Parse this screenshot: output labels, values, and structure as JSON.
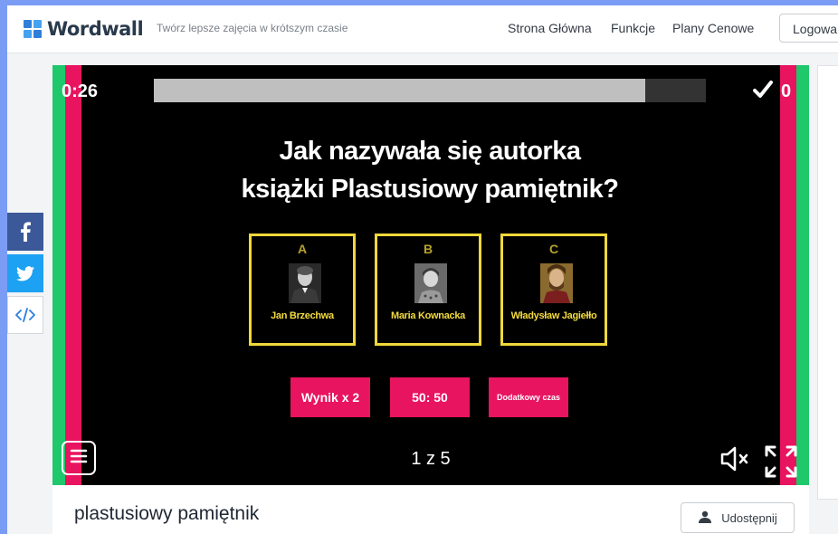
{
  "header": {
    "logo_text": "Wordwall",
    "tagline": "Twórz lepsze zajęcia w krótszym czasie",
    "nav": [
      "Strona Główna",
      "Funkcje",
      "Plany Cenowe"
    ],
    "login_label": "Logowa"
  },
  "social": {
    "facebook": "facebook-icon",
    "twitter": "twitter-icon",
    "embed": "embed-code-icon"
  },
  "game": {
    "timer": "0:26",
    "progress": 0.89,
    "score": "0",
    "question_line1": "Jak nazywała się autorka",
    "question_line2": "książki Plastusiowy pamiętnik?",
    "answers": [
      {
        "letter": "A",
        "name": "Jan Brzechwa"
      },
      {
        "letter": "B",
        "name": "Maria Kownacka"
      },
      {
        "letter": "C",
        "name": "Władysław Jagiełło"
      }
    ],
    "powerups": [
      "Wynik x 2",
      "50: 50",
      "Dodatkowy czas"
    ],
    "counter": "1 z 5",
    "colors": {
      "accent_pink": "#e8145f",
      "accent_green": "#1ec86b",
      "answer_border": "#f0d83a"
    }
  },
  "activity": {
    "title": "plastusiowy pamiętnik",
    "share_label": "Udostępnij"
  }
}
